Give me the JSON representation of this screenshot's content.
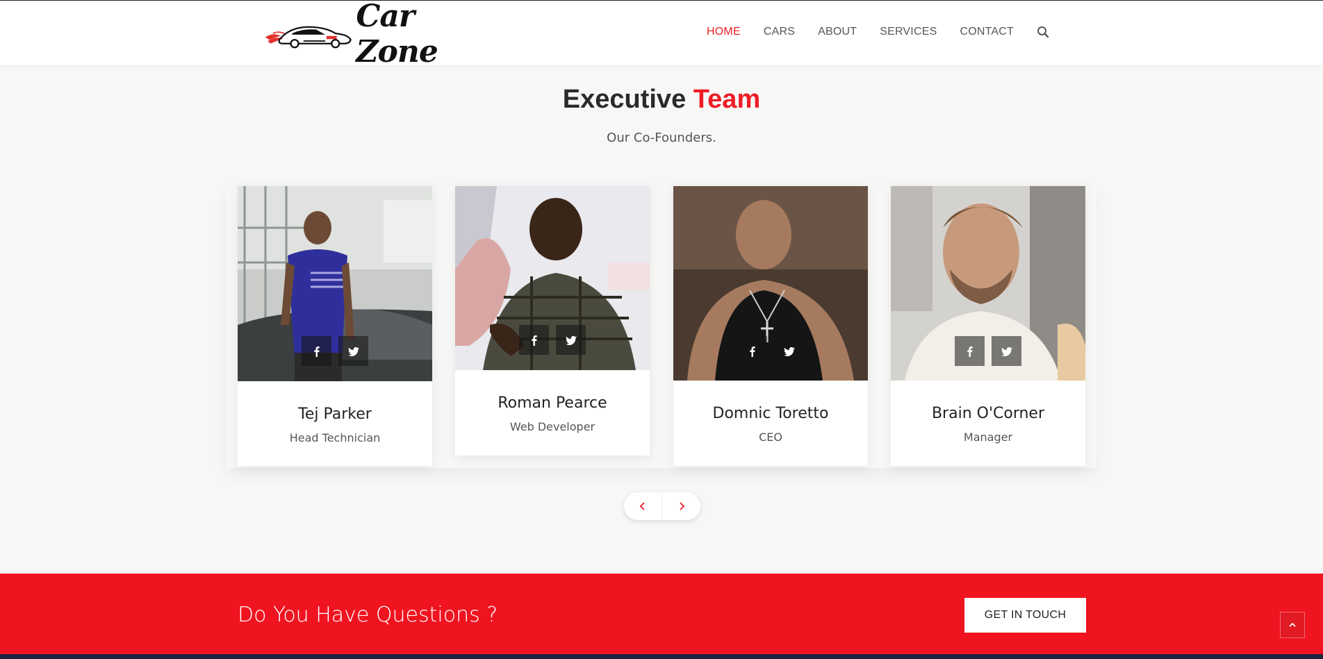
{
  "brand": {
    "name": "Car Zone"
  },
  "nav": {
    "items": [
      {
        "label": "HOME",
        "active": true
      },
      {
        "label": "CARS",
        "active": false
      },
      {
        "label": "ABOUT",
        "active": false
      },
      {
        "label": "SERVICES",
        "active": false
      },
      {
        "label": "CONTACT",
        "active": false
      }
    ],
    "search_icon": "search-icon"
  },
  "section": {
    "title_part1": "Executive",
    "title_part2": "Team",
    "subtitle": "Our Co-Founders."
  },
  "team": [
    {
      "name": "Tej Parker",
      "role": "Head Technician"
    },
    {
      "name": "Roman Pearce",
      "role": "Web Developer"
    },
    {
      "name": "Domnic Toretto",
      "role": "CEO"
    },
    {
      "name": "Brain O'Corner",
      "role": "Manager"
    }
  ],
  "cta": {
    "text": "Do You Have Questions ?",
    "button": "GET IN TOUCH"
  },
  "colors": {
    "accent": "#ee1c25",
    "footer": "#1c2340"
  }
}
